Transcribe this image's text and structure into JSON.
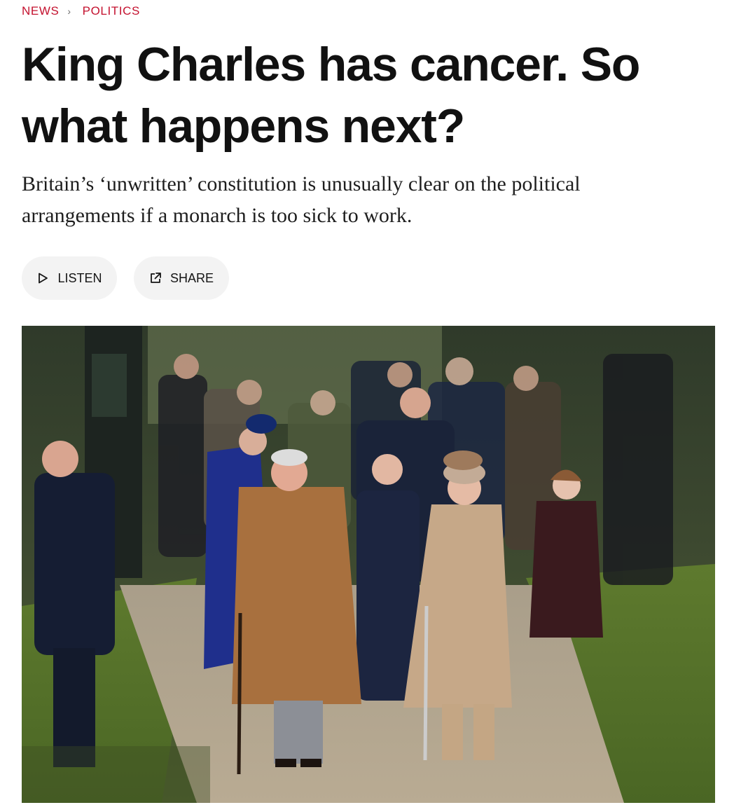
{
  "breadcrumb": {
    "section": "NEWS",
    "subsection": "POLITICS"
  },
  "headline": "King Charles has cancer. So what happens next?",
  "dek": "Britain’s ‘unwritten’ constitution is unusually clear on the political arrangements if a monarch is too sick to work.",
  "actions": {
    "listen_label": "LISTEN",
    "share_label": "SHARE",
    "listen_icon": "play-icon",
    "share_icon": "external-share-icon"
  },
  "colors": {
    "accent": "#c4122f",
    "headline": "#111111",
    "pill_bg": "#f3f3f3"
  }
}
